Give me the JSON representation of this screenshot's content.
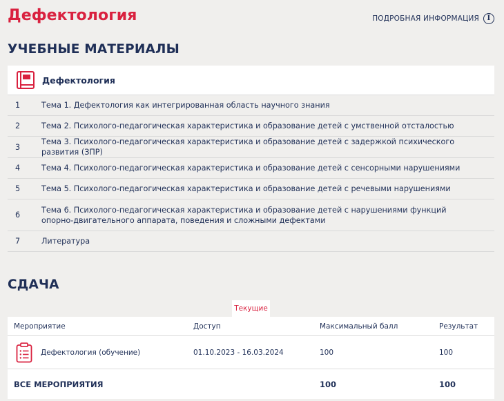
{
  "page": {
    "title": "Дефектология",
    "info_link": "Подробная информация"
  },
  "materials": {
    "heading": "УЧЕБНЫЕ МАТЕРИАЛЫ",
    "course_title": "Дефектология",
    "items": [
      {
        "num": "1",
        "label": "Тема 1. Дефектология как интегрированная область научного знания"
      },
      {
        "num": "2",
        "label": "Тема 2. Психолого-педагогическая характеристика и образование детей с умственной отсталостью"
      },
      {
        "num": "3",
        "label": "Тема 3. Психолого-педагогическая характеристика и образование детей с задержкой психического развития (ЗПР)"
      },
      {
        "num": "4",
        "label": "Тема 4. Психолого-педагогическая характеристика и образование детей с сенсорными нарушениями"
      },
      {
        "num": "5",
        "label": "Тема 5. Психолого-педагогическая характеристика и образование детей с речевыми нарушениями"
      },
      {
        "num": "6",
        "label": "Тема 6. Психолого-педагогическая характеристика и образование детей с нарушениями функций опорно-двигательного аппарата, поведения и сложными дефектами"
      },
      {
        "num": "7",
        "label": "Литература"
      }
    ]
  },
  "submission": {
    "heading": "СДАЧА",
    "tab_label": "Текущие",
    "columns": [
      "Мероприятие",
      "Доступ",
      "Максимальный балл",
      "Результат"
    ],
    "rows": [
      {
        "event": "Дефектология (обучение)",
        "access": "01.10.2023 - 16.03.2024",
        "max_score": "100",
        "result": "100"
      }
    ],
    "total": {
      "label": "ВСЕ МЕРОПРИЯТИЯ",
      "max_score": "100",
      "result": "100"
    }
  },
  "colors": {
    "accent": "#d9213f",
    "text": "#1f2f57",
    "background": "#f0efed"
  },
  "icons": {
    "info": "info-icon",
    "course": "book-icon",
    "event": "clipboard-icon"
  }
}
